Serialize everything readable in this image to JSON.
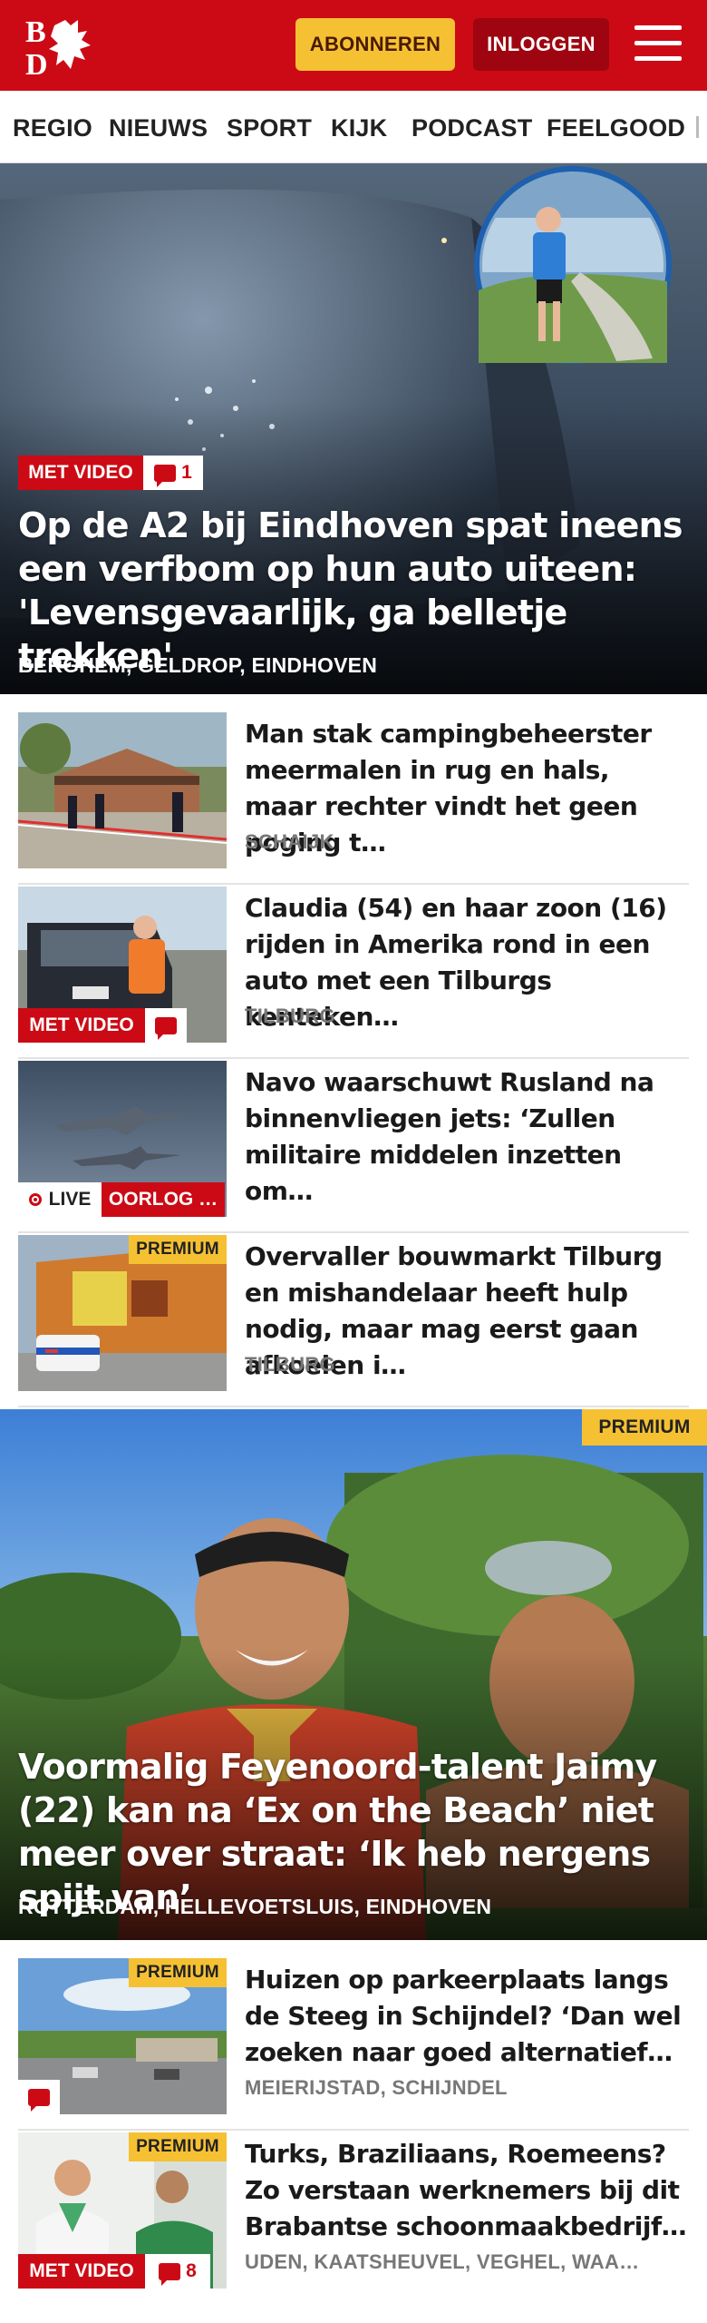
{
  "header": {
    "logo_text": "BD",
    "subscribe_label": "ABONNEREN",
    "login_label": "INLOGGEN",
    "colors": {
      "brand_red": "#cc0a15",
      "accent_yellow": "#f5c133",
      "dark_red": "#9e0510"
    }
  },
  "nav": {
    "items": [
      "REGIO",
      "NIEUWS",
      "SPORT",
      "KIJK",
      "PODCAST",
      "FEELGOOD"
    ]
  },
  "hero1": {
    "badge": "MET VIDEO",
    "comments": "1",
    "title": "Op de A2 bij Eindhoven spat ineens een verfbom op hun auto uiteen: 'Levensgevaarlijk, ga belletje trekken'",
    "location": "BERGHEM, GELDROP, EINDHOVEN"
  },
  "list1": [
    {
      "title": "Man stak campingbeheerster meermalen in rug en hals, maar rechter vindt het geen poging t…",
      "location": "SCHAIJK"
    },
    {
      "title": "Claudia (54) en haar zoon (16) rijden in Amerika rond in een auto met een Tilburgs kenteken…",
      "location": "TILBURG",
      "badge": "MET VIDEO"
    },
    {
      "title": "Navo waarschuwt Rusland na binnenvliegen jets: ‘Zullen militaire middelen inzetten om…",
      "location": "",
      "live_label": "LIVE",
      "tag": "OORLOG …"
    },
    {
      "title": "Overvaller bouwmarkt Tilburg en mishandelaar heeft hulp nodig, maar mag eerst gaan afkoelen i…",
      "location": "TILBURG",
      "premium": "PREMIUM"
    }
  ],
  "hero2": {
    "premium": "PREMIUM",
    "title": "Voormalig Feyenoord-talent Jaimy (22) kan na ‘Ex on the Beach’ niet meer over straat: ‘Ik heb nergens spijt van’",
    "location": "ROTTERDAM, HELLEVOETSLUIS, EINDHOVEN"
  },
  "list2": [
    {
      "title": "Huizen op parkeerplaats langs de Steeg in Schijndel? ‘Dan wel zoeken naar goed alternatief…",
      "location": "MEIERIJSTAD, SCHIJNDEL",
      "premium": "PREMIUM"
    },
    {
      "title": "Turks, Braziliaans, Roemeens? Zo verstaan werknemers bij dit Brabantse schoonmaakbedrijf…",
      "location": "UDEN, KAATSHEUVEL, VEGHEL, WAA…",
      "premium": "PREMIUM",
      "badge": "MET VIDEO",
      "comments": "8"
    }
  ]
}
